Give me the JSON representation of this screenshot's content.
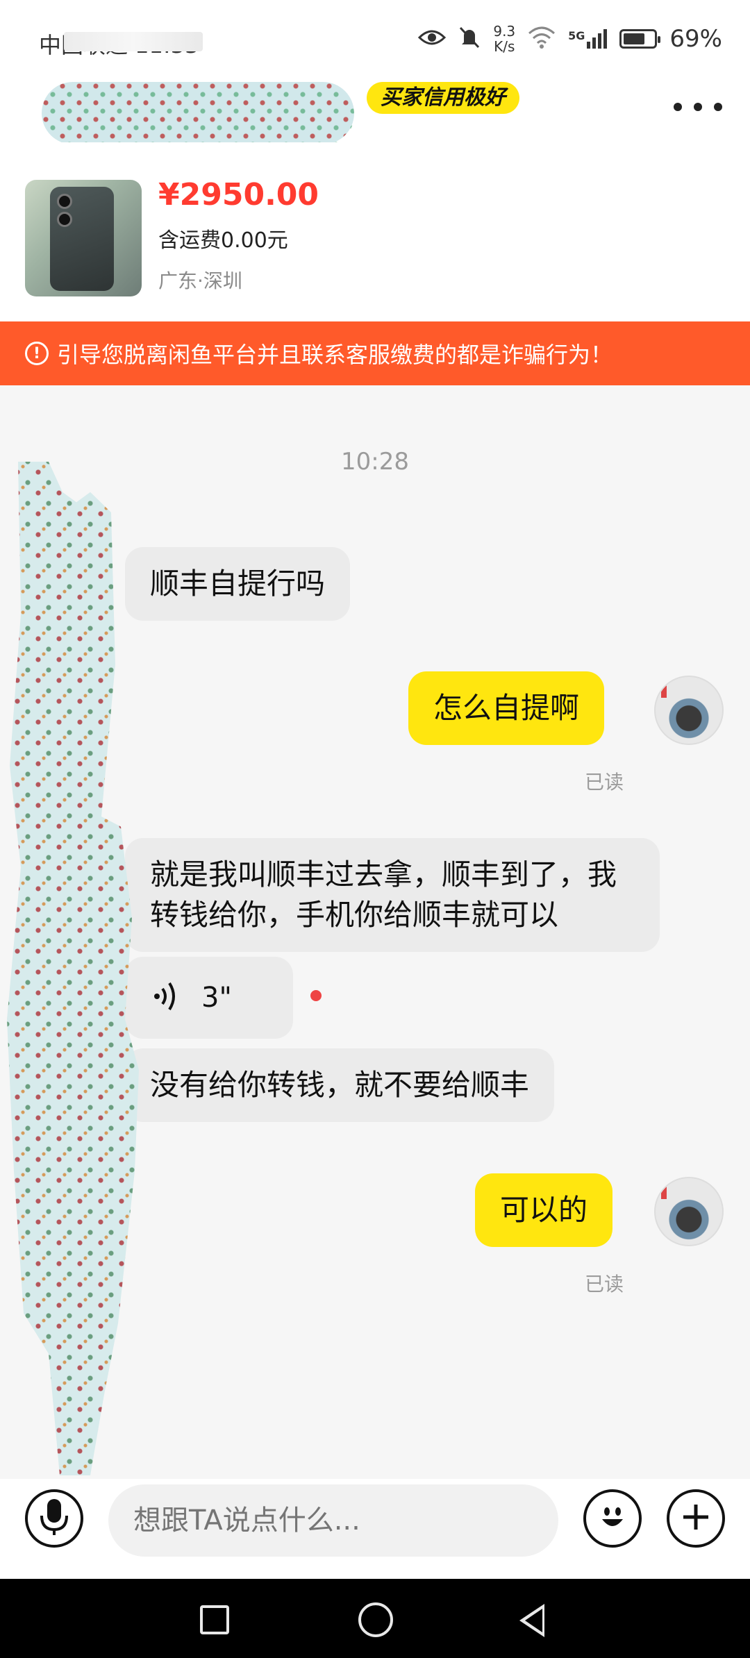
{
  "status_bar": {
    "carrier": "中国联通 11:33",
    "network_speed_value": "9.3",
    "network_speed_unit": "K/s",
    "signal_label": "5G",
    "battery_percent": "69%",
    "battery_level": 0.69,
    "icons": [
      "eye-icon",
      "mute-bell-icon",
      "wifi-icon",
      "signal-icon",
      "battery-icon"
    ]
  },
  "header": {
    "credit_badge": "买家信用极好",
    "more_icon": "more-dots-icon"
  },
  "product": {
    "price": "¥2950.00",
    "shipping": "含运费0.00元",
    "location": "广东·深圳"
  },
  "warning": {
    "icon": "!",
    "text": "引导您脱离闲鱼平台并且联系客服缴费的都是诈骗行为！"
  },
  "chat": {
    "timestamp": "10:28",
    "messages": [
      {
        "side": "in",
        "text": "顺丰自提行吗"
      },
      {
        "side": "out",
        "text": "怎么自提啊",
        "status": "已读"
      },
      {
        "side": "in",
        "text": "就是我叫顺丰过去拿，顺丰到了，我转钱给你，手机你给顺丰就可以"
      },
      {
        "side": "in",
        "text": "没有给你转钱，就不要给顺丰"
      },
      {
        "side": "out",
        "text": "可以的",
        "status": "已读"
      }
    ],
    "voice": {
      "duration": "3\"",
      "icon": "voice-waves-icon"
    }
  },
  "input": {
    "placeholder": "想跟TA说点什么...",
    "icons": [
      "mic-icon",
      "emoji-icon",
      "plus-icon"
    ]
  },
  "nav": {
    "icons": [
      "recent-apps-icon",
      "home-icon",
      "back-icon"
    ]
  }
}
